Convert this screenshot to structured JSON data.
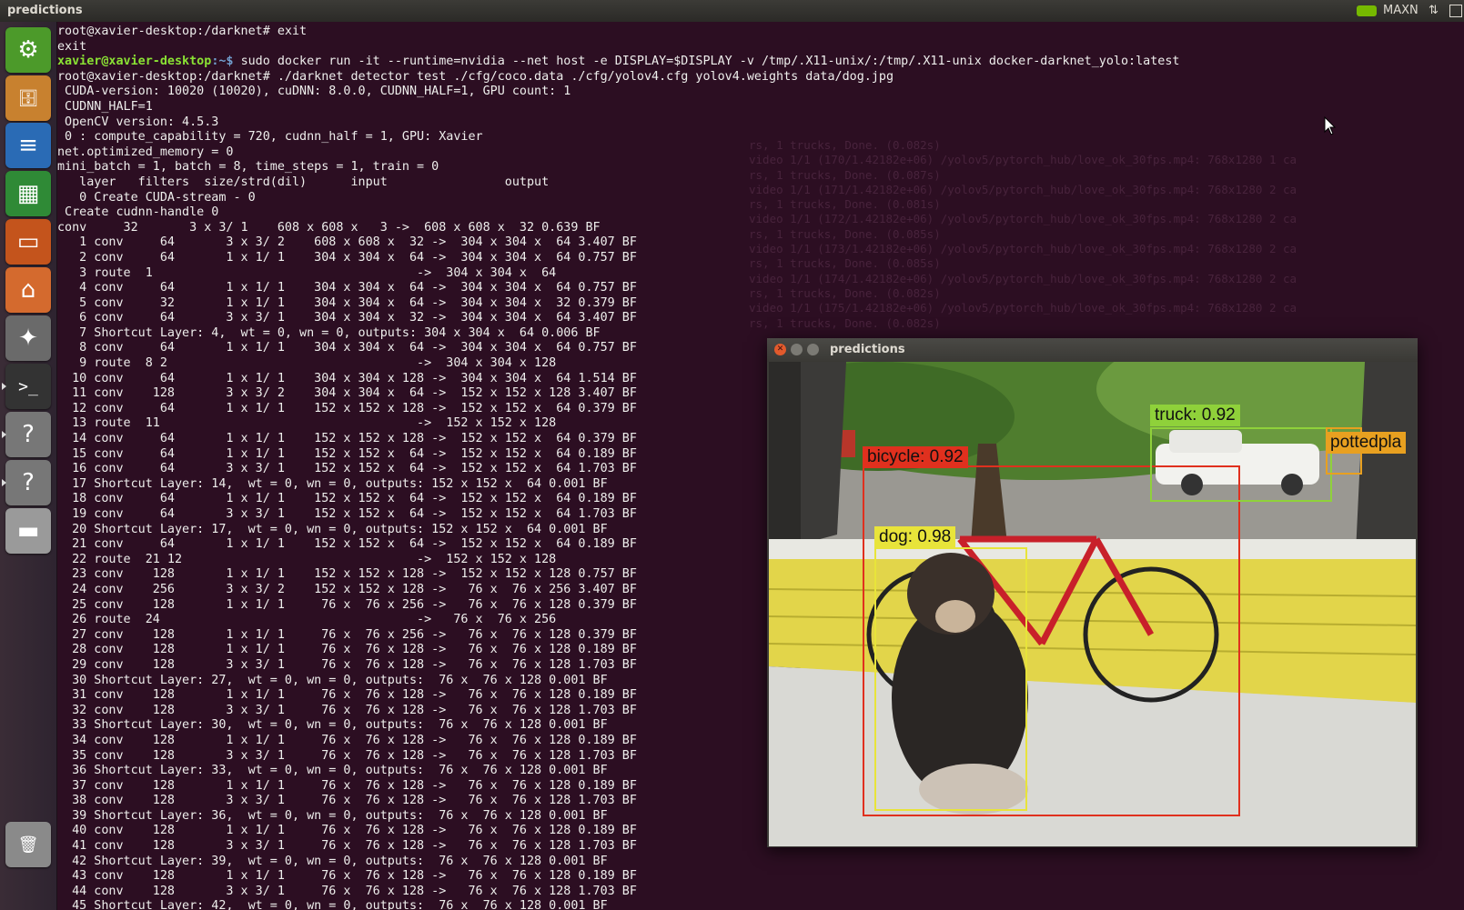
{
  "topbar": {
    "title": "predictions",
    "power_mode": "MAXN",
    "network_icon": "updown-arrows-icon",
    "nvidia_icon": "nvidia-logo-icon"
  },
  "launcher": {
    "items": [
      {
        "name": "ubuntu-dash",
        "icon": "ubuntu-logo-icon",
        "glyph": "⚙",
        "color": "#4c9a2a"
      },
      {
        "name": "files",
        "icon": "file-cabinet-icon",
        "glyph": "🗄",
        "color": "#c8812f"
      },
      {
        "name": "writer",
        "icon": "document-icon",
        "glyph": "≡",
        "color": "#2a6bb5"
      },
      {
        "name": "calc",
        "icon": "spreadsheet-icon",
        "glyph": "▦",
        "color": "#2f8a36"
      },
      {
        "name": "impress",
        "icon": "presentation-icon",
        "glyph": "▭",
        "color": "#c4541c"
      },
      {
        "name": "software-center",
        "icon": "shopping-bag-icon",
        "glyph": "⌂",
        "color": "#d46a2e"
      },
      {
        "name": "settings",
        "icon": "wrench-gear-icon",
        "glyph": "✦",
        "color": "#6a6a6a"
      },
      {
        "name": "terminal",
        "icon": "terminal-icon",
        "glyph": ">_",
        "color": "#333333"
      },
      {
        "name": "unknown-app-1",
        "icon": "question-mark-icon",
        "glyph": "?",
        "color": "#777777"
      },
      {
        "name": "unknown-app-2",
        "icon": "question-mark-icon",
        "glyph": "?",
        "color": "#777777"
      },
      {
        "name": "drive",
        "icon": "drive-icon",
        "glyph": "▬",
        "color": "#9a9a9a"
      },
      {
        "name": "trash",
        "icon": "trash-icon",
        "glyph": "🗑",
        "color": "#8a8a8a"
      }
    ]
  },
  "terminal": {
    "prompt_user": "xavier@xavier-desktop",
    "prompt_path": ":~$ ",
    "docker_command": "sudo docker run -it --runtime=nvidia --net host -e DISPLAY=$DISPLAY -v /tmp/.X11-unix/:/tmp/.X11-unix docker-darknet_yolo:latest",
    "lines_before": [
      "root@xavier-desktop:/darknet# exit",
      "exit"
    ],
    "lines_after": [
      "root@xavier-desktop:/darknet# ./darknet detector test ./cfg/coco.data ./cfg/yolov4.cfg yolov4.weights data/dog.jpg",
      " CUDA-version: 10020 (10020), cuDNN: 8.0.0, CUDNN_HALF=1, GPU count: 1",
      " CUDNN_HALF=1",
      " OpenCV version: 4.5.3",
      " 0 : compute_capability = 720, cudnn_half = 1, GPU: Xavier",
      "net.optimized_memory = 0",
      "mini_batch = 1, batch = 8, time_steps = 1, train = 0",
      "   layer   filters  size/strd(dil)      input                output",
      "   0 Create CUDA-stream - 0",
      " Create cudnn-handle 0",
      "conv     32       3 x 3/ 1    608 x 608 x   3 ->  608 x 608 x  32 0.639 BF",
      "   1 conv     64       3 x 3/ 2    608 x 608 x  32 ->  304 x 304 x  64 3.407 BF",
      "   2 conv     64       1 x 1/ 1    304 x 304 x  64 ->  304 x 304 x  64 0.757 BF",
      "   3 route  1                                    ->  304 x 304 x  64",
      "   4 conv     64       1 x 1/ 1    304 x 304 x  64 ->  304 x 304 x  64 0.757 BF",
      "   5 conv     32       1 x 1/ 1    304 x 304 x  64 ->  304 x 304 x  32 0.379 BF",
      "   6 conv     64       3 x 3/ 1    304 x 304 x  32 ->  304 x 304 x  64 3.407 BF",
      "   7 Shortcut Layer: 4,  wt = 0, wn = 0, outputs: 304 x 304 x  64 0.006 BF",
      "   8 conv     64       1 x 1/ 1    304 x 304 x  64 ->  304 x 304 x  64 0.757 BF",
      "   9 route  8 2                                  ->  304 x 304 x 128",
      "  10 conv     64       1 x 1/ 1    304 x 304 x 128 ->  304 x 304 x  64 1.514 BF",
      "  11 conv    128       3 x 3/ 2    304 x 304 x  64 ->  152 x 152 x 128 3.407 BF",
      "  12 conv     64       1 x 1/ 1    152 x 152 x 128 ->  152 x 152 x  64 0.379 BF",
      "  13 route  11                                   ->  152 x 152 x 128",
      "  14 conv     64       1 x 1/ 1    152 x 152 x 128 ->  152 x 152 x  64 0.379 BF",
      "  15 conv     64       1 x 1/ 1    152 x 152 x  64 ->  152 x 152 x  64 0.189 BF",
      "  16 conv     64       3 x 3/ 1    152 x 152 x  64 ->  152 x 152 x  64 1.703 BF",
      "  17 Shortcut Layer: 14,  wt = 0, wn = 0, outputs: 152 x 152 x  64 0.001 BF",
      "  18 conv     64       1 x 1/ 1    152 x 152 x  64 ->  152 x 152 x  64 0.189 BF",
      "  19 conv     64       3 x 3/ 1    152 x 152 x  64 ->  152 x 152 x  64 1.703 BF",
      "  20 Shortcut Layer: 17,  wt = 0, wn = 0, outputs: 152 x 152 x  64 0.001 BF",
      "  21 conv     64       1 x 1/ 1    152 x 152 x  64 ->  152 x 152 x  64 0.189 BF",
      "  22 route  21 12                                ->  152 x 152 x 128",
      "  23 conv    128       1 x 1/ 1    152 x 152 x 128 ->  152 x 152 x 128 0.757 BF",
      "  24 conv    256       3 x 3/ 2    152 x 152 x 128 ->   76 x  76 x 256 3.407 BF",
      "  25 conv    128       1 x 1/ 1     76 x  76 x 256 ->   76 x  76 x 128 0.379 BF",
      "  26 route  24                                   ->   76 x  76 x 256",
      "  27 conv    128       1 x 1/ 1     76 x  76 x 256 ->   76 x  76 x 128 0.379 BF",
      "  28 conv    128       1 x 1/ 1     76 x  76 x 128 ->   76 x  76 x 128 0.189 BF",
      "  29 conv    128       3 x 3/ 1     76 x  76 x 128 ->   76 x  76 x 128 1.703 BF",
      "  30 Shortcut Layer: 27,  wt = 0, wn = 0, outputs:  76 x  76 x 128 0.001 BF",
      "  31 conv    128       1 x 1/ 1     76 x  76 x 128 ->   76 x  76 x 128 0.189 BF",
      "  32 conv    128       3 x 3/ 1     76 x  76 x 128 ->   76 x  76 x 128 1.703 BF",
      "  33 Shortcut Layer: 30,  wt = 0, wn = 0, outputs:  76 x  76 x 128 0.001 BF",
      "  34 conv    128       1 x 1/ 1     76 x  76 x 128 ->   76 x  76 x 128 0.189 BF",
      "  35 conv    128       3 x 3/ 1     76 x  76 x 128 ->   76 x  76 x 128 1.703 BF",
      "  36 Shortcut Layer: 33,  wt = 0, wn = 0, outputs:  76 x  76 x 128 0.001 BF",
      "  37 conv    128       1 x 1/ 1     76 x  76 x 128 ->   76 x  76 x 128 0.189 BF",
      "  38 conv    128       3 x 3/ 1     76 x  76 x 128 ->   76 x  76 x 128 1.703 BF",
      "  39 Shortcut Layer: 36,  wt = 0, wn = 0, outputs:  76 x  76 x 128 0.001 BF",
      "  40 conv    128       1 x 1/ 1     76 x  76 x 128 ->   76 x  76 x 128 0.189 BF",
      "  41 conv    128       3 x 3/ 1     76 x  76 x 128 ->   76 x  76 x 128 1.703 BF",
      "  42 Shortcut Layer: 39,  wt = 0, wn = 0, outputs:  76 x  76 x 128 0.001 BF",
      "  43 conv    128       1 x 1/ 1     76 x  76 x 128 ->   76 x  76 x 128 0.189 BF",
      "  44 conv    128       3 x 3/ 1     76 x  76 x 128 ->   76 x  76 x 128 1.703 BF",
      "  45 Shortcut Layer: 42,  wt = 0, wn = 0, outputs:  76 x  76 x 128 0.001 BF"
    ],
    "background_ghost_lines": [
      "rs, 1 trucks, Done. (0.082s)",
      "video 1/1 (170/1.42182e+06) /yolov5/pytorch_hub/love_ok_30fps.mp4: 768x1280 1 ca",
      "rs, 1 trucks, Done. (0.087s)",
      "video 1/1 (171/1.42182e+06) /yolov5/pytorch_hub/love_ok_30fps.mp4: 768x1280 2 ca",
      "rs, 1 trucks, Done. (0.081s)",
      "video 1/1 (172/1.42182e+06) /yolov5/pytorch_hub/love_ok_30fps.mp4: 768x1280 2 ca",
      "rs, 1 trucks, Done. (0.085s)",
      "video 1/1 (173/1.42182e+06) /yolov5/pytorch_hub/love_ok_30fps.mp4: 768x1280 2 ca",
      "rs, 1 trucks, Done. (0.085s)",
      "video 1/1 (174/1.42182e+06) /yolov5/pytorch_hub/love_ok_30fps.mp4: 768x1280 2 ca",
      "rs, 1 trucks, Done. (0.082s)",
      "video 1/1 (175/1.42182e+06) /yolov5/pytorch_hub/love_ok_30fps.mp4: 768x1280 2 ca",
      "rs, 1 trucks, Done. (0.082s)"
    ]
  },
  "predictions_window": {
    "title": "predictions",
    "close_icon": "close-icon",
    "minimize_icon": "minimize-icon",
    "maximize_icon": "maximize-icon",
    "detections": [
      {
        "label": "bicycle: 0.92",
        "class": "bicycle",
        "color": "#e0301e"
      },
      {
        "label": "dog: 0.98",
        "class": "dog",
        "color": "#e8e43a"
      },
      {
        "label": "truck: 0.92",
        "class": "truck",
        "color": "#8fd13a"
      },
      {
        "label": "pottedpla",
        "class": "pottedplant",
        "color": "#e8a020"
      }
    ]
  }
}
